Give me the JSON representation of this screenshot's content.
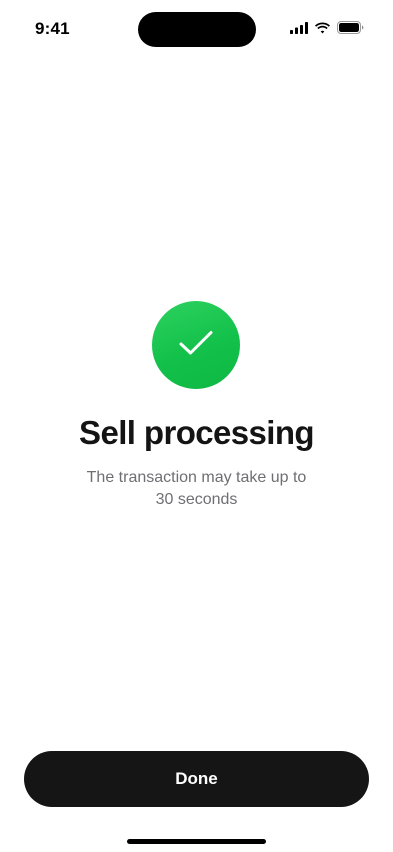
{
  "status_bar": {
    "time": "9:41",
    "icons": [
      "cellular-signal-icon",
      "wifi-icon",
      "battery-icon"
    ]
  },
  "main": {
    "badge_icon": "checkmark-icon",
    "badge_color": "#17c650",
    "title": "Sell processing",
    "subtitle": "The transaction may take up to 30 seconds"
  },
  "footer": {
    "done_label": "Done",
    "button_color": "#151515"
  }
}
